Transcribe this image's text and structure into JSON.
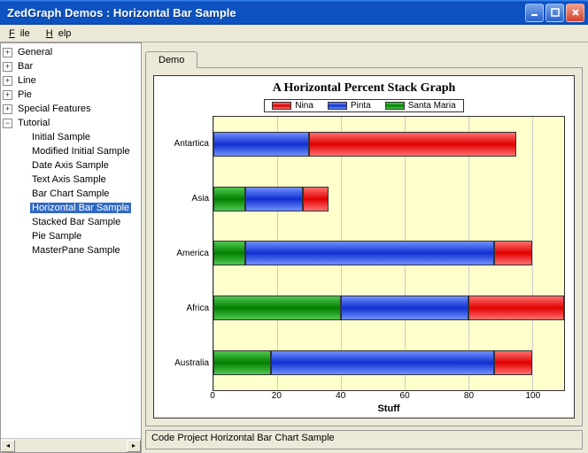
{
  "window": {
    "title": "ZedGraph Demos : Horizontal Bar Sample"
  },
  "menu": {
    "file": "File",
    "help": "Help"
  },
  "tree": {
    "nodes": [
      {
        "label": "General",
        "expanded": false,
        "depth": 0
      },
      {
        "label": "Bar",
        "expanded": false,
        "depth": 0
      },
      {
        "label": "Line",
        "expanded": false,
        "depth": 0
      },
      {
        "label": "Pie",
        "expanded": false,
        "depth": 0
      },
      {
        "label": "Special Features",
        "expanded": false,
        "depth": 0
      },
      {
        "label": "Tutorial",
        "expanded": true,
        "depth": 0
      },
      {
        "label": "Initial Sample",
        "leaf": true,
        "depth": 1
      },
      {
        "label": "Modified Initial Sample",
        "leaf": true,
        "depth": 1
      },
      {
        "label": "Date Axis Sample",
        "leaf": true,
        "depth": 1
      },
      {
        "label": "Text Axis Sample",
        "leaf": true,
        "depth": 1
      },
      {
        "label": "Bar Chart Sample",
        "leaf": true,
        "depth": 1
      },
      {
        "label": "Horizontal Bar Sample",
        "leaf": true,
        "depth": 1,
        "selected": true
      },
      {
        "label": "Stacked Bar Sample",
        "leaf": true,
        "depth": 1
      },
      {
        "label": "Pie Sample",
        "leaf": true,
        "depth": 1
      },
      {
        "label": "MasterPane Sample",
        "leaf": true,
        "depth": 1
      }
    ]
  },
  "tab": {
    "label": "Demo"
  },
  "status": {
    "text": "Code Project Horizontal Bar Chart Sample"
  },
  "chart_data": {
    "type": "bar",
    "orientation": "horizontal",
    "stacked": true,
    "title": "A Horizontal Percent Stack Graph",
    "xlabel": "Stuff",
    "xlim": [
      0,
      110
    ],
    "xticks": [
      0,
      20,
      40,
      60,
      80,
      100
    ],
    "categories": [
      "Antartica",
      "Asia",
      "America",
      "Africa",
      "Australia"
    ],
    "series": [
      {
        "name": "Nina",
        "color": "red",
        "values": [
          65,
          8,
          12,
          30,
          12
        ]
      },
      {
        "name": "Pinta",
        "color": "blue",
        "values": [
          30,
          18,
          78,
          40,
          70
        ]
      },
      {
        "name": "Santa Maria",
        "color": "green",
        "values": [
          0,
          10,
          10,
          40,
          18
        ]
      }
    ],
    "render_order": [
      "green",
      "blue",
      "red"
    ]
  }
}
